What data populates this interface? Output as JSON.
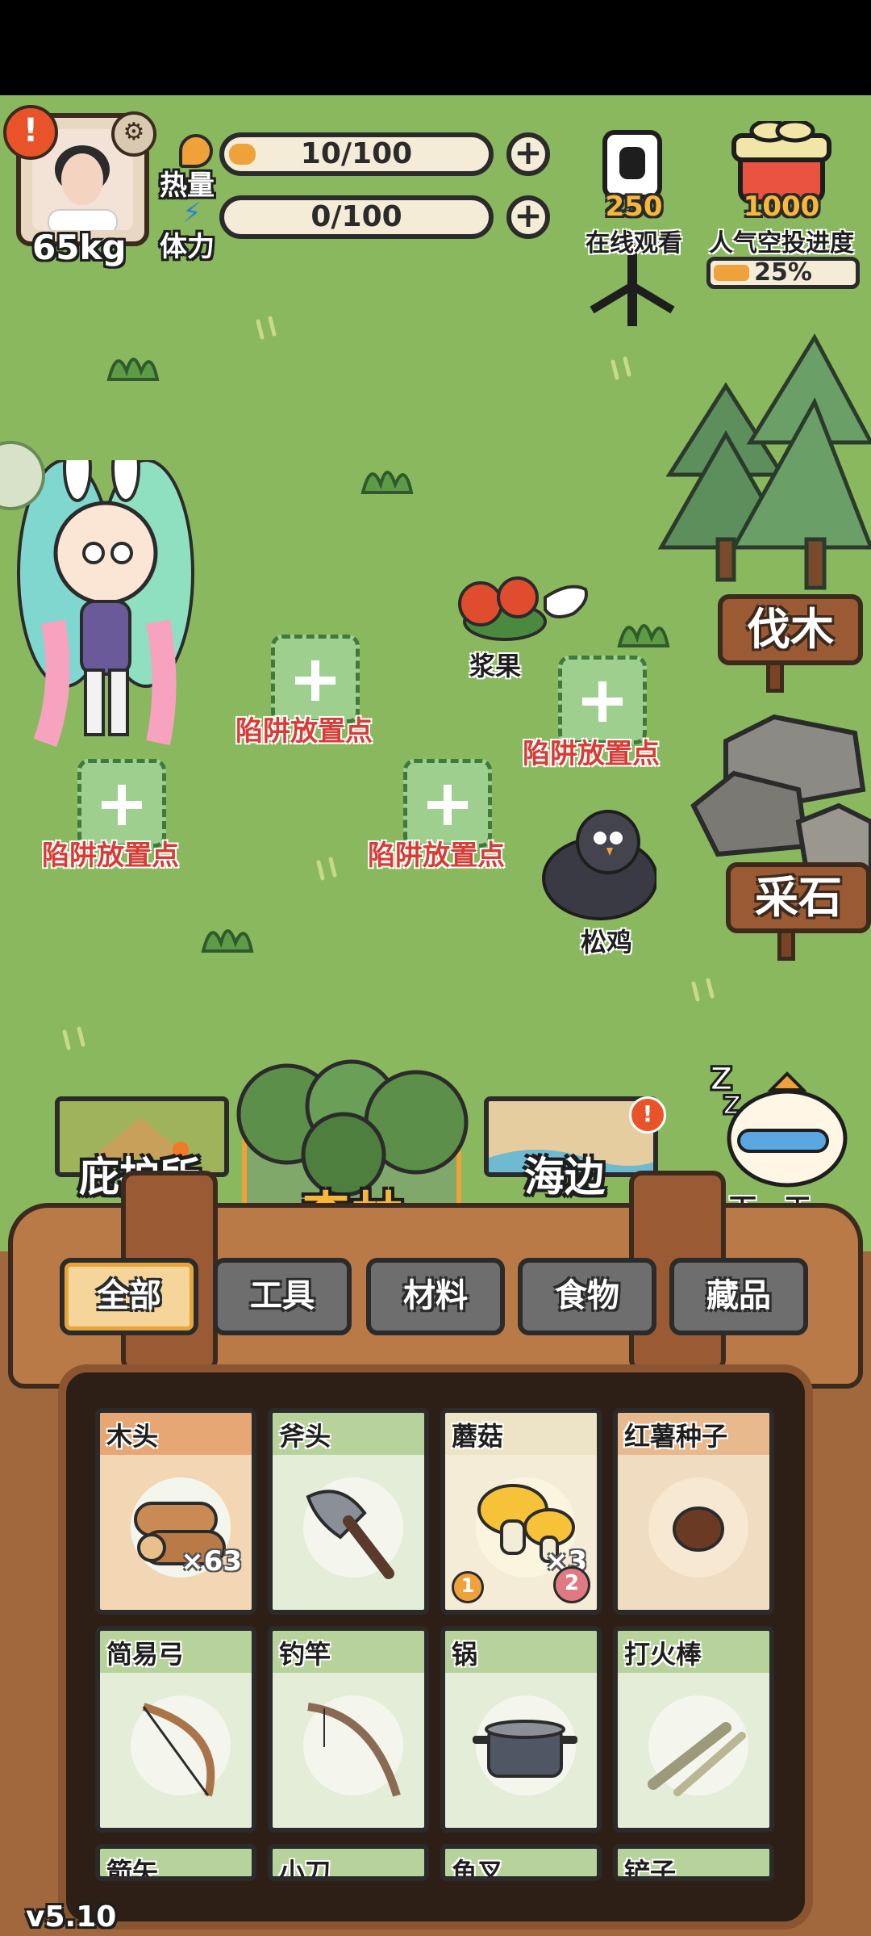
{
  "player": {
    "weight": "65kg"
  },
  "stats": {
    "heat": {
      "label": "热量",
      "value": "10/100",
      "fill": 0.1
    },
    "stamina": {
      "label": "体力",
      "value": "0/100",
      "fill": 0.0
    }
  },
  "live": {
    "viewers": "250",
    "label": "在线观看"
  },
  "airdrop": {
    "count": "1000",
    "label": "人气空投进度",
    "progress": "25%",
    "fill": 0.25
  },
  "map": {
    "traps": [
      "陷阱放置点",
      "陷阱放置点",
      "陷阱放置点",
      "陷阱放置点"
    ],
    "resources": {
      "berry": "浆果",
      "bird": "松鸡"
    },
    "signs": {
      "chop": "伐木",
      "mine": "采石"
    }
  },
  "locations": {
    "shelter": "庇护所",
    "forest": "森林",
    "beach": "海边",
    "next_day": "下一天"
  },
  "inventory": {
    "tabs": [
      "全部",
      "工具",
      "材料",
      "食物",
      "藏品"
    ],
    "items": [
      {
        "name": "木头",
        "count": "×63"
      },
      {
        "name": "斧头",
        "count": ""
      },
      {
        "name": "蘑菇",
        "count": "×3",
        "badges": [
          "1",
          "2"
        ]
      },
      {
        "name": "红薯种子",
        "count": ""
      },
      {
        "name": "简易弓",
        "count": ""
      },
      {
        "name": "钓竿",
        "count": ""
      },
      {
        "name": "锅",
        "count": ""
      },
      {
        "name": "打火棒",
        "count": ""
      },
      {
        "name": "箭矢",
        "count": ""
      },
      {
        "name": "小刀",
        "count": ""
      },
      {
        "name": "鱼叉",
        "count": ""
      },
      {
        "name": "铲子",
        "count": ""
      }
    ]
  },
  "version": "v5.10",
  "colors": {
    "grass": "#8ab85e",
    "wood": "#9a5a34",
    "accent": "#f6b73b",
    "trap_text": "#d73c35"
  }
}
